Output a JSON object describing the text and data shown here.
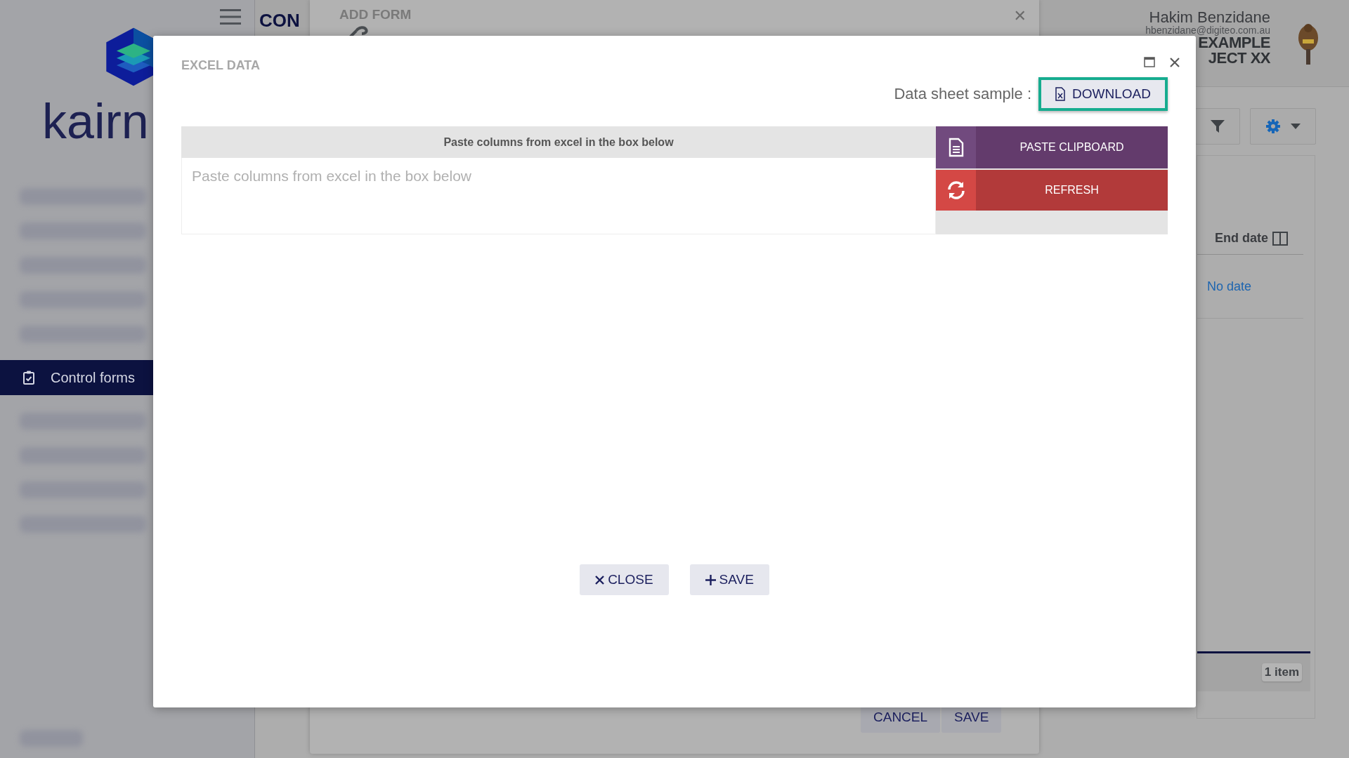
{
  "sidebar": {
    "logo_text": "kairn",
    "items": [
      {
        "label": "Control forms",
        "selected": true
      }
    ]
  },
  "header": {
    "title": "CON",
    "user_name": "Hakim Benzidane",
    "user_email": "hbenzidane@digiteo.com.au",
    "project_line_1": "EXAMPLE",
    "project_line_2": "JECT XX"
  },
  "background_form": {
    "title": "ADD FORM",
    "close_glyph": "✕",
    "buttons": [
      "CANCEL",
      "SAVE"
    ]
  },
  "list": {
    "column": "End date",
    "cell": "No date",
    "count": "1 item"
  },
  "dialog": {
    "title": "EXCEL DATA",
    "sample_label": "Data sheet sample :",
    "download_button": "DOWNLOAD",
    "download_highlighted": true,
    "table_header": "Paste columns from excel in the box below",
    "paste_placeholder": "Paste columns from excel in the box below",
    "actions": [
      {
        "kind": "paste",
        "label": "PASTE CLIPBOARD"
      },
      {
        "kind": "refresh",
        "label": "REFRESH"
      }
    ],
    "footer_buttons": [
      {
        "kind": "close",
        "label": "CLOSE"
      },
      {
        "kind": "save",
        "label": "SAVE"
      }
    ]
  }
}
